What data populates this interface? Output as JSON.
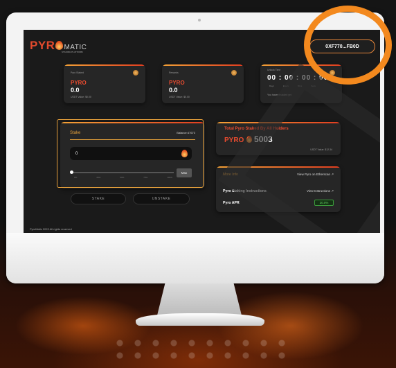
{
  "app": {
    "logo_pyro": "PYR",
    "logo_matic": "MATIC",
    "logo_tagline": "STAKING PLATFORM"
  },
  "wallet": {
    "address": "0XF770...FB0D"
  },
  "stats": [
    {
      "label": "Pyro Staked",
      "token": "PYRO",
      "value": "0.0",
      "subvalue": "USDT Value: $0.00"
    },
    {
      "label": "Rewards",
      "token": "PYRO",
      "value": "0.0",
      "subvalue": "USDT Value: $0.00"
    }
  ],
  "unlock": {
    "label": "Unlock Time",
    "time": "00 : 00 : 00 : 00",
    "units": [
      "Days",
      "Hours",
      "Mins",
      "Secs"
    ],
    "note": "You haven't staked yet"
  },
  "stake": {
    "title": "Stake",
    "balance": "Balance:47673",
    "input_value": "0",
    "ticks": [
      "0%",
      "25%",
      "50%",
      "75%",
      "100%"
    ],
    "max_label": "Max",
    "stake_button": "STAKE",
    "unstake_button": "UNSTAKE"
  },
  "total": {
    "title": "Total Pyro Staked By All Holders",
    "token": "PYRO",
    "value": "5003",
    "subvalue": "USDT Value: $12.34"
  },
  "more_info": {
    "title": "More Info",
    "etherscan_link": "View Pyro on Etherscan",
    "instructions_label": "Pyro Staking Instructions",
    "instructions_link": "View Instructions",
    "apr_label": "Pyro APR",
    "apr_value": "20.0%"
  },
  "footer": {
    "text": "PyroMatic 2022 All rights reserved"
  },
  "colors": {
    "accent": "#e94b2f",
    "highlight": "#f3891e",
    "gold": "#e8a23a"
  }
}
